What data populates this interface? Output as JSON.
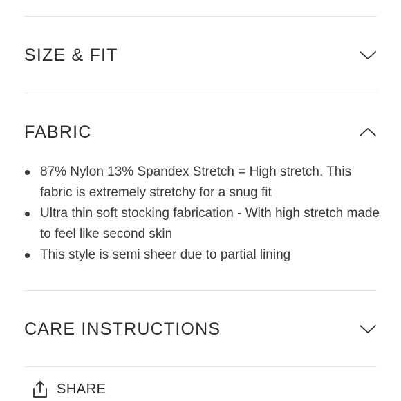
{
  "sections": {
    "size_fit": {
      "title": "SIZE & FIT",
      "expanded": false,
      "chevron_icon": "chevron-down-icon"
    },
    "fabric": {
      "title": "FABRIC",
      "expanded": true,
      "chevron_icon": "chevron-up-icon",
      "items": [
        "87% Nylon 13% Spandex Stretch = High stretch. This fabric is extremely stretchy for a snug fit",
        "Ultra thin soft stocking fabrication - With high stretch made to feel like second skin",
        "This style is semi sheer due to partial lining"
      ]
    },
    "care": {
      "title": "CARE INSTRUCTIONS",
      "expanded": false,
      "chevron_icon": "chevron-down-icon"
    }
  },
  "share": {
    "label": "SHARE",
    "icon": "share-icon"
  },
  "colors": {
    "text": "#2e2e2e",
    "divider": "#e4e4e4",
    "background": "#ffffff"
  }
}
